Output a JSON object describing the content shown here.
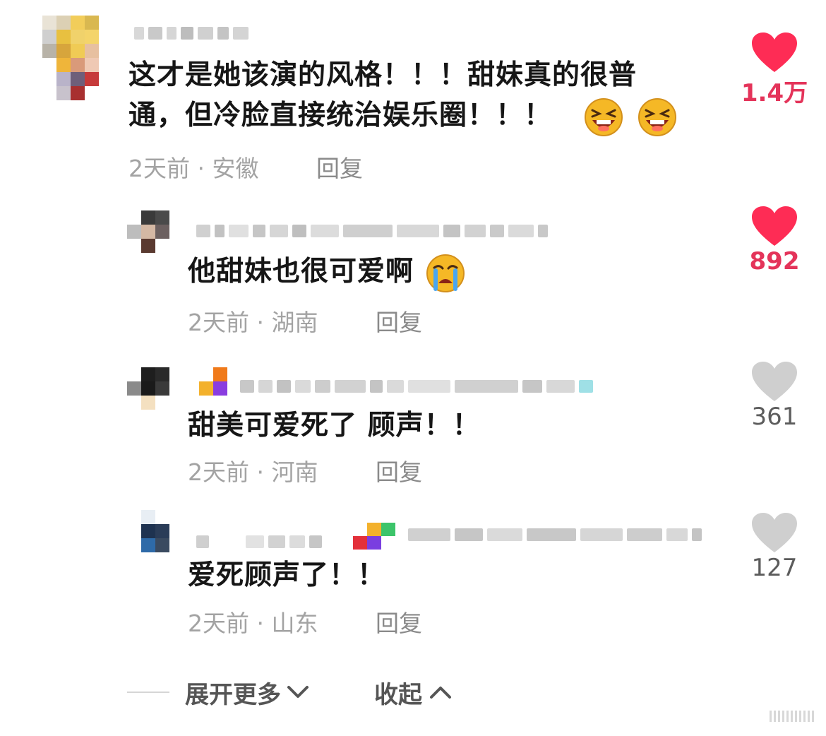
{
  "comments": [
    {
      "text_line1": "这才是她该演的风格！！！甜妹真的很普",
      "text_line2": "通，但冷脸直接统治娱乐圈！！！",
      "emoji": [
        "laugh-emoji",
        "laugh-emoji"
      ],
      "time": "2天前",
      "location": "安徽",
      "reply_label": "回复",
      "likes": "1.4万",
      "liked": true
    },
    {
      "text": "他甜妹也很可爱啊",
      "emoji": [
        "crying-emoji"
      ],
      "time": "2天前",
      "location": "湖南",
      "reply_label": "回复",
      "likes": "892",
      "liked": true
    },
    {
      "text": "甜美可爱死了 顾声！！",
      "time": "2天前",
      "location": "河南",
      "reply_label": "回复",
      "likes": "361",
      "liked": false
    },
    {
      "text": "爱死顾声了！！",
      "time": "2天前",
      "location": "山东",
      "reply_label": "回复",
      "likes": "127",
      "liked": false
    }
  ],
  "footer": {
    "expand_label": "展开更多",
    "collapse_label": "收起"
  },
  "colors": {
    "liked": "#fe2c55",
    "unliked": "#cfcfcf",
    "liked_count": "#e4345a",
    "unliked_count": "#5c5c5c",
    "meta": "#a3a3a3"
  },
  "icons": {
    "like": "heart-icon",
    "expand": "chevron-down-icon",
    "collapse": "chevron-up-icon"
  }
}
